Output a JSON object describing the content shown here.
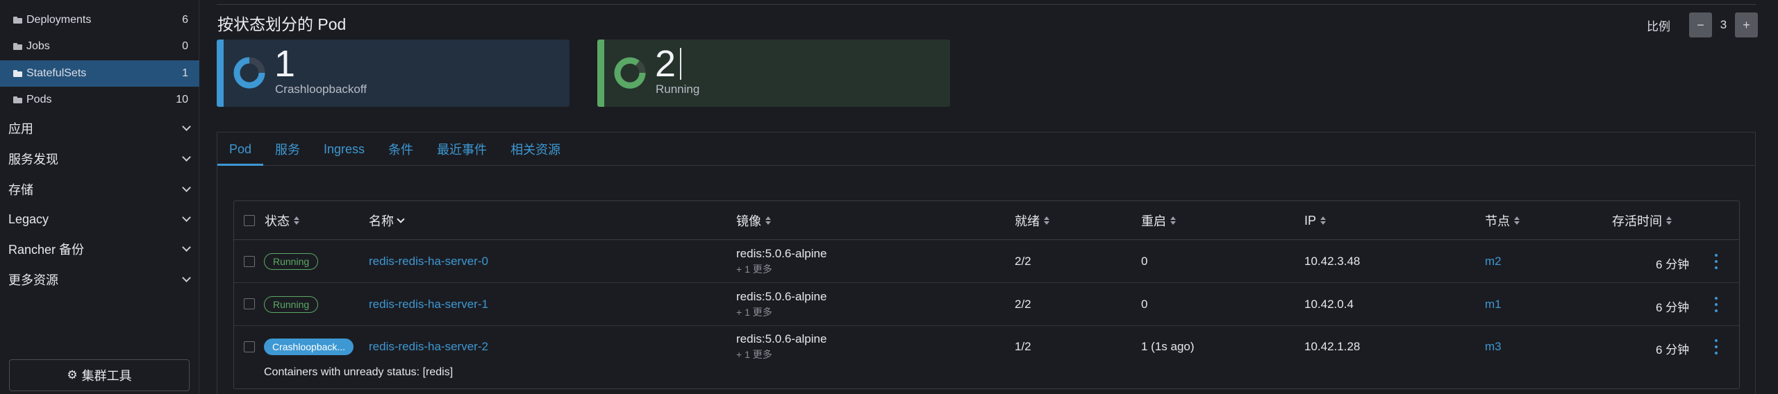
{
  "sidebar": {
    "sub_items": [
      {
        "label": "Deployments",
        "count": "6"
      },
      {
        "label": "Jobs",
        "count": "0"
      },
      {
        "label": "StatefulSets",
        "count": "1"
      },
      {
        "label": "Pods",
        "count": "10"
      }
    ],
    "groups": [
      {
        "label": "应用"
      },
      {
        "label": "服务发现"
      },
      {
        "label": "存储"
      },
      {
        "label": "Legacy"
      },
      {
        "label": "Rancher 备份"
      },
      {
        "label": "更多资源"
      }
    ],
    "cluster_tools_label": "集群工具"
  },
  "main": {
    "title": "按状态划分的 Pod",
    "scale": {
      "label": "比例",
      "minus": "−",
      "value": "3",
      "plus": "+"
    },
    "cards": [
      {
        "count": "1",
        "label": "Crashloopbackoff",
        "color": "#3d98d3"
      },
      {
        "count": "2",
        "label": "Running",
        "color": "#5aa865"
      }
    ],
    "tabs": [
      {
        "label": "Pod"
      },
      {
        "label": "服务"
      },
      {
        "label": "Ingress"
      },
      {
        "label": "条件"
      },
      {
        "label": "最近事件"
      },
      {
        "label": "相关资源"
      }
    ],
    "table": {
      "headers": {
        "status": "状态",
        "name": "名称",
        "image": "镜像",
        "ready": "就绪",
        "restarts": "重启",
        "ip": "IP",
        "node": "节点",
        "age": "存活时间"
      },
      "rows": [
        {
          "status": "Running",
          "name": "redis-redis-ha-server-0",
          "image": "redis:5.0.6-alpine",
          "image_more": "+ 1 更多",
          "ready": "2/2",
          "restarts": "0",
          "ip": "10.42.3.48",
          "node": "m2",
          "age": "6 分钟"
        },
        {
          "status": "Running",
          "name": "redis-redis-ha-server-1",
          "image": "redis:5.0.6-alpine",
          "image_more": "+ 1 更多",
          "ready": "2/2",
          "restarts": "0",
          "ip": "10.42.0.4",
          "node": "m1",
          "age": "6 分钟"
        },
        {
          "status": "Crashloopback...",
          "name": "redis-redis-ha-server-2",
          "image": "redis:5.0.6-alpine",
          "image_more": "+ 1 更多",
          "ready": "1/2",
          "restarts": "1 (1s ago)",
          "ip": "10.42.1.28",
          "node": "m3",
          "age": "6 分钟",
          "note": "Containers with unready status: [redis]"
        }
      ]
    }
  }
}
